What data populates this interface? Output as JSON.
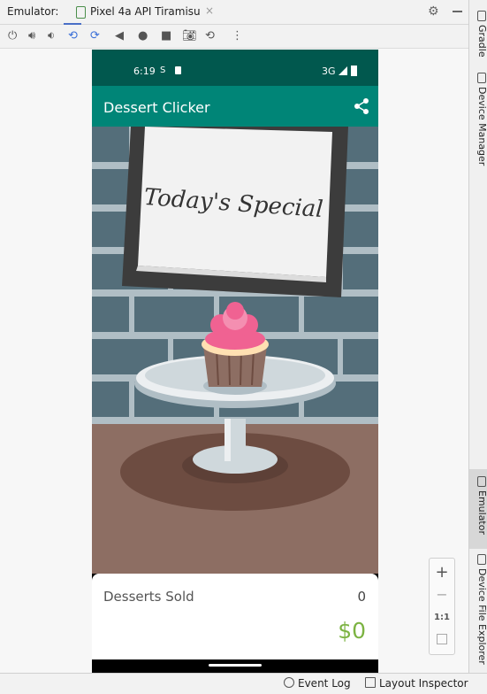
{
  "window": {
    "tool_label": "Emulator:",
    "device_tab": "Pixel 4a API Tiramisu",
    "close_glyph": "×"
  },
  "toolbar_icons": [
    "power-icon",
    "volume-up-icon",
    "volume-down-icon",
    "rotate-left-icon",
    "rotate-right-icon",
    "back-icon",
    "home-icon",
    "overview-icon",
    "camera-icon",
    "snapshot-icon",
    "more-icon"
  ],
  "right_tabs": {
    "gradle": "Gradle",
    "device_manager": "Device Manager",
    "emulator": "Emulator",
    "device_file_explorer": "Device File Explorer"
  },
  "status_bar": {
    "event_log": "Event Log",
    "layout_inspector": "Layout Inspector"
  },
  "zoom": {
    "plus": "+",
    "minus": "−",
    "one_to_one": "1:1"
  },
  "phone": {
    "time": "6:19",
    "network": "3G",
    "app_title": "Dessert Clicker",
    "sign_text": "Today's Special",
    "desserts_sold_label": "Desserts Sold",
    "desserts_sold_value": "0",
    "revenue": "$0"
  },
  "colors": {
    "status_bar": "#01584e",
    "app_bar": "#008577",
    "revenue": "#7cb342",
    "brick": "#546e7a",
    "mortar": "#b0bec5",
    "table": "#8d6e63",
    "frosting": "#f06292"
  }
}
